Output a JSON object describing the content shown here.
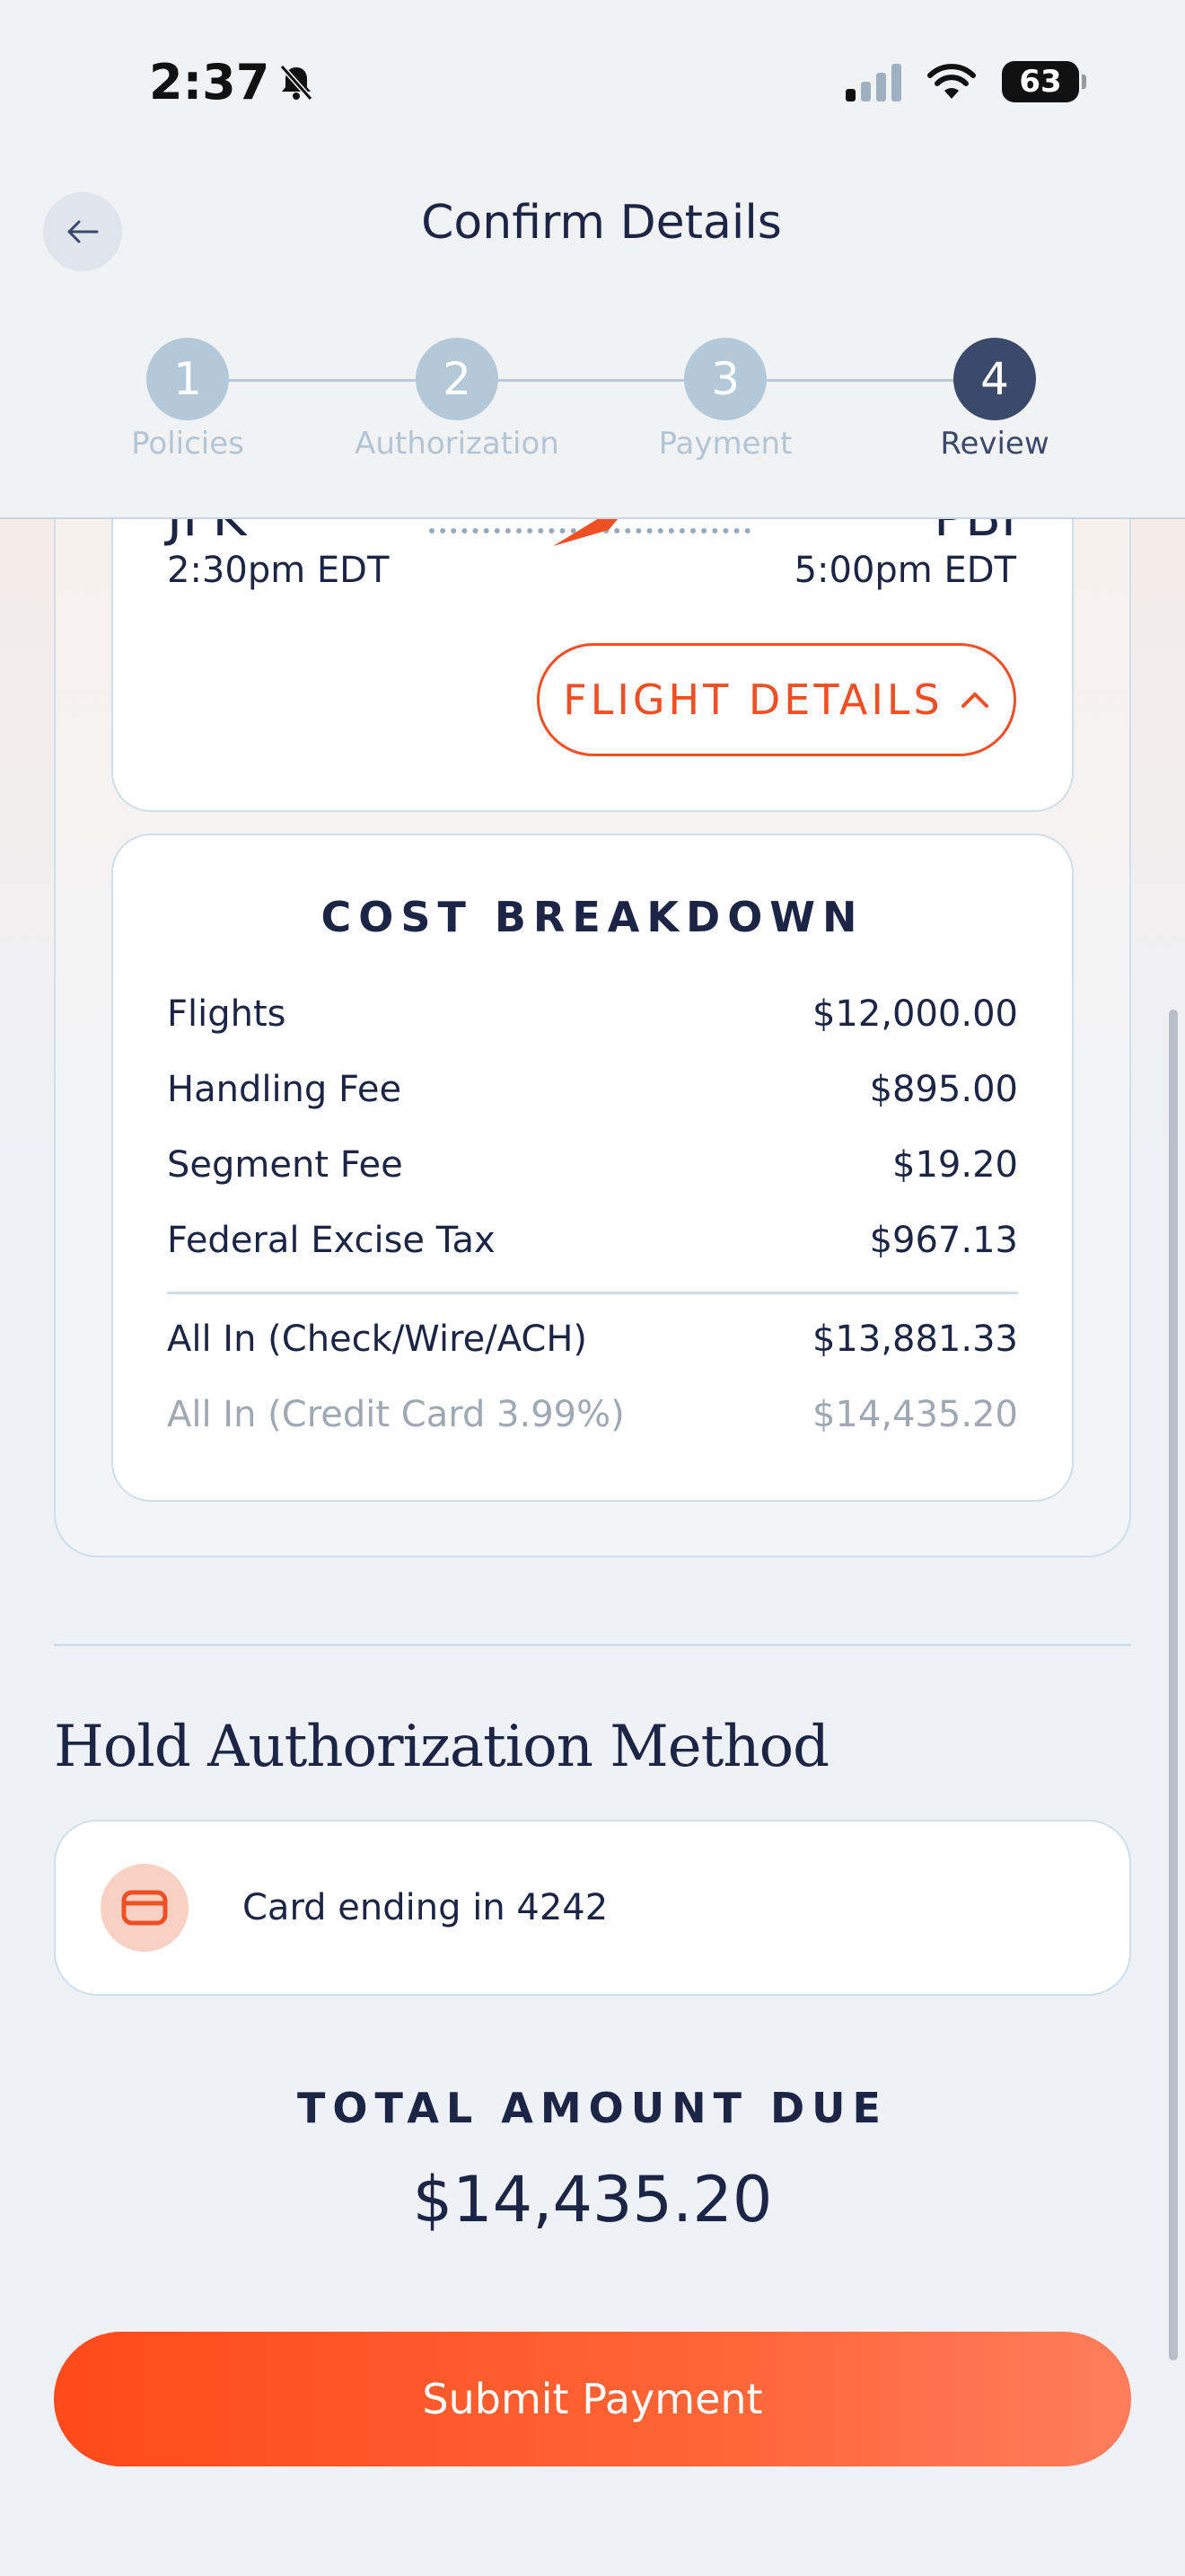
{
  "status_bar": {
    "time": "2:37",
    "battery": "63"
  },
  "header": {
    "title": "Confirm Details"
  },
  "stepper": {
    "steps": [
      {
        "number": "1",
        "label": "Policies"
      },
      {
        "number": "2",
        "label": "Authorization"
      },
      {
        "number": "3",
        "label": "Payment"
      },
      {
        "number": "4",
        "label": "Review"
      }
    ],
    "active_step": 4
  },
  "flight": {
    "departure_code": "JFK",
    "arrival_code": "PBI",
    "departure_time": "2:30pm EDT",
    "arrival_time": "5:00pm EDT",
    "details_button": "FLIGHT DETAILS"
  },
  "cost_breakdown": {
    "title": "COST BREAKDOWN",
    "items": [
      {
        "label": "Flights",
        "value": "$12,000.00"
      },
      {
        "label": "Handling Fee",
        "value": "$895.00"
      },
      {
        "label": "Segment Fee",
        "value": "$19.20"
      },
      {
        "label": "Federal Excise Tax",
        "value": "$967.13"
      }
    ],
    "totals": [
      {
        "label": "All In (Check/Wire/ACH)",
        "value": "$13,881.33"
      },
      {
        "label": "All In (Credit Card 3.99%)",
        "value": "$14,435.20"
      }
    ]
  },
  "hold_authorization": {
    "heading": "Hold Authorization Method",
    "card_text": "Card ending in 4242",
    "icon": "credit-card-icon"
  },
  "total": {
    "label": "TOTAL AMOUNT DUE",
    "value": "$14,435.20"
  },
  "submit": {
    "label": "Submit Payment"
  },
  "colors": {
    "accent": "#f04e23",
    "navy": "#1c2545",
    "step_active": "#3b4a6b",
    "step_inactive": "#b3c9d9"
  }
}
